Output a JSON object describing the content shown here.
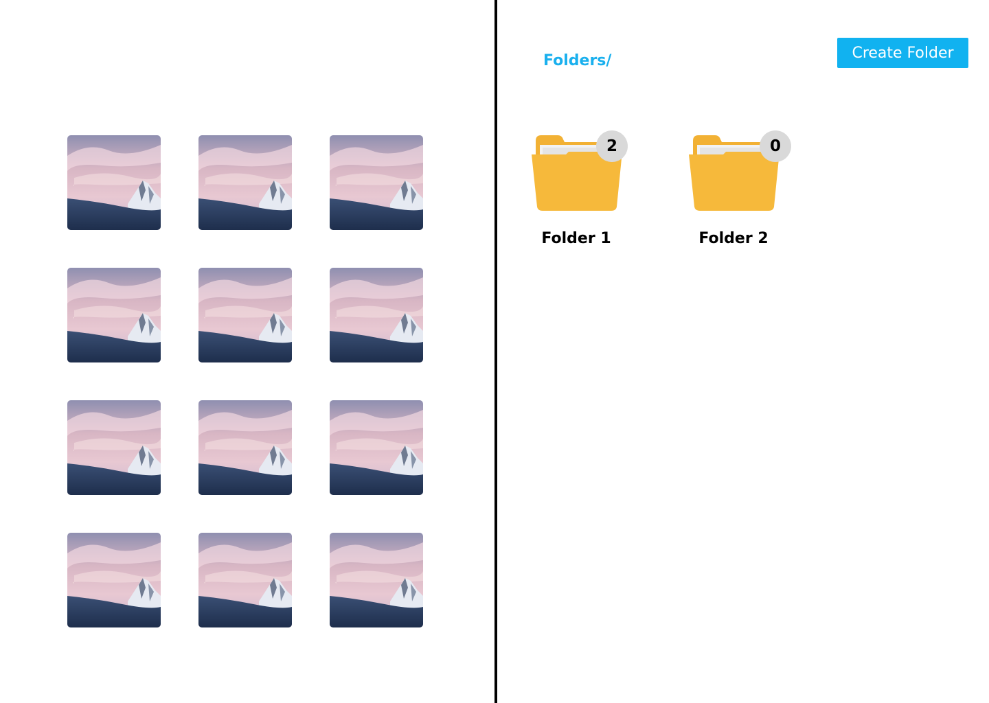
{
  "gallery": {
    "images": [
      {
        "alt": "mountain-peak-photo"
      },
      {
        "alt": "mountain-peak-photo"
      },
      {
        "alt": "mountain-peak-photo"
      },
      {
        "alt": "mountain-peak-photo"
      },
      {
        "alt": "mountain-peak-photo"
      },
      {
        "alt": "mountain-peak-photo"
      },
      {
        "alt": "mountain-peak-photo"
      },
      {
        "alt": "mountain-peak-photo"
      },
      {
        "alt": "mountain-peak-photo"
      },
      {
        "alt": "mountain-peak-photo"
      },
      {
        "alt": "mountain-peak-photo"
      },
      {
        "alt": "mountain-peak-photo"
      }
    ]
  },
  "header": {
    "breadcrumb": "Folders/",
    "create_button_label": "Create Folder"
  },
  "folders": [
    {
      "name": "Folder 1",
      "count": "2"
    },
    {
      "name": "Folder 2",
      "count": "0"
    }
  ],
  "colors": {
    "accent": "#11b2f0",
    "breadcrumb": "#1ab0ee",
    "folder": "#f5b83a",
    "badge": "#d9d9d9",
    "divider": "#000000"
  }
}
